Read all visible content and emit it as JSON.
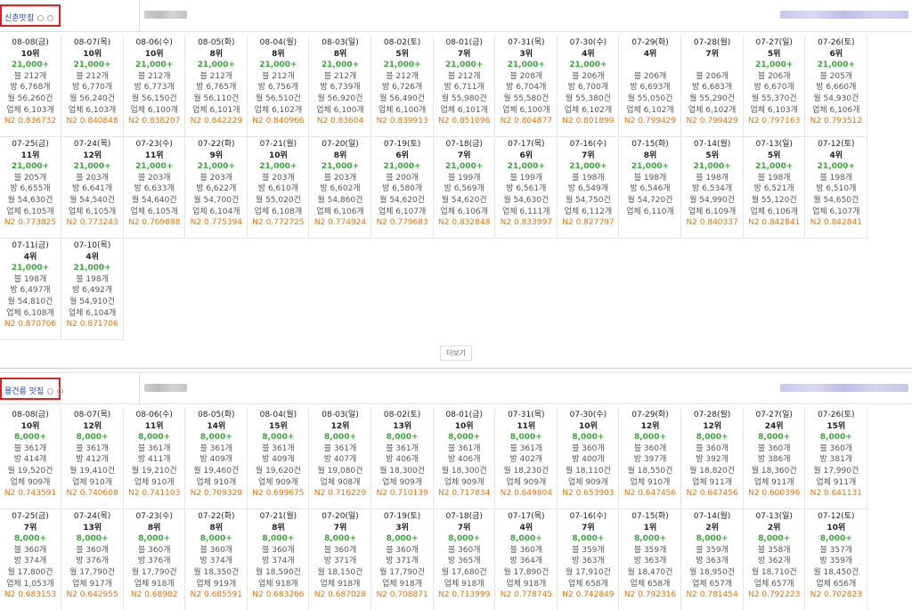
{
  "sections": [
    {
      "keyword": "신촌맛집",
      "more_label": "더보기",
      "rows": [
        [
          {
            "date": "08-08(금)",
            "rank": "10위",
            "amount": "21,000+",
            "blog": "블 212개",
            "cafe": "방 6,768개",
            "month": "월 56,260건",
            "biz": "업체 6,103개",
            "n2": "N2 0.836732"
          },
          {
            "date": "08-07(목)",
            "rank": "10위",
            "amount": "21,000+",
            "blog": "블 212개",
            "cafe": "방 6,770개",
            "month": "월 56,240건",
            "biz": "업체 6,103개",
            "n2": "N2 0.840848"
          },
          {
            "date": "08-06(수)",
            "rank": "10위",
            "amount": "21,000+",
            "blog": "블 212개",
            "cafe": "방 6,773개",
            "month": "월 56,150건",
            "biz": "업체 6,100개",
            "n2": "N2 0.838207"
          },
          {
            "date": "08-05(화)",
            "rank": "8위",
            "amount": "21,000+",
            "blog": "블 212개",
            "cafe": "방 6,765개",
            "month": "월 56,110건",
            "biz": "업체 6,101개",
            "n2": "N2 0.842229"
          },
          {
            "date": "08-04(월)",
            "rank": "8위",
            "amount": "21,000+",
            "blog": "블 212개",
            "cafe": "방 6,756개",
            "month": "월 56,510건",
            "biz": "업체 6,102개",
            "n2": "N2 0.840966"
          },
          {
            "date": "08-03(일)",
            "rank": "8위",
            "amount": "21,000+",
            "blog": "블 212개",
            "cafe": "방 6,739개",
            "month": "월 56,920건",
            "biz": "업체 6,100개",
            "n2": "N2 0.83604"
          },
          {
            "date": "08-02(토)",
            "rank": "5위",
            "amount": "21,000+",
            "blog": "블 212개",
            "cafe": "방 6,726개",
            "month": "월 56,490건",
            "biz": "업체 6,100개",
            "n2": "N2 0.839913"
          },
          {
            "date": "08-01(금)",
            "rank": "7위",
            "amount": "21,000+",
            "blog": "블 212개",
            "cafe": "방 6,711개",
            "month": "월 55,980건",
            "biz": "업체 6,101개",
            "n2": "N2 0.851096"
          },
          {
            "date": "07-31(목)",
            "rank": "3위",
            "amount": "21,000+",
            "blog": "블 208개",
            "cafe": "방 6,704개",
            "month": "월 55,580건",
            "biz": "업체 6,100개",
            "n2": "N2 0.804877"
          },
          {
            "date": "07-30(수)",
            "rank": "4위",
            "amount": "21,000+",
            "blog": "블 206개",
            "cafe": "방 6,700개",
            "month": "월 55,380건",
            "biz": "업체 6,102개",
            "n2": "N2 0.801899"
          },
          {
            "date": "07-29(화)",
            "rank": "4위",
            "amount": "",
            "blog": "블 206개",
            "cafe": "방 6,693개",
            "month": "월 55,050건",
            "biz": "업체 6,102개",
            "n2": "N2 0.799429"
          },
          {
            "date": "07-28(월)",
            "rank": "7위",
            "amount": "",
            "blog": "블 206개",
            "cafe": "방 6,683개",
            "month": "월 55,290건",
            "biz": "업체 6,102개",
            "n2": "N2 0.799429"
          },
          {
            "date": "07-27(일)",
            "rank": "5위",
            "amount": "21,000+",
            "blog": "블 206개",
            "cafe": "방 6,670개",
            "month": "월 55,370건",
            "biz": "업체 6,103개",
            "n2": "N2 0.797163"
          },
          {
            "date": "07-26(토)",
            "rank": "6위",
            "amount": "21,000+",
            "blog": "블 205개",
            "cafe": "방 6,660개",
            "month": "월 54,930건",
            "biz": "업체 6,106개",
            "n2": "N2 0.793512"
          }
        ],
        [
          {
            "date": "07-25(금)",
            "rank": "11위",
            "amount": "21,000+",
            "blog": "블 205개",
            "cafe": "방 6,655개",
            "month": "월 54,630건",
            "biz": "업체 6,105개",
            "n2": "N2 0.773825"
          },
          {
            "date": "07-24(목)",
            "rank": "12위",
            "amount": "21,000+",
            "blog": "블 203개",
            "cafe": "방 6,641개",
            "month": "월 54,540건",
            "biz": "업체 6,105개",
            "n2": "N2 0.773243"
          },
          {
            "date": "07-23(수)",
            "rank": "11위",
            "amount": "21,000+",
            "blog": "블 203개",
            "cafe": "방 6,633개",
            "month": "월 54,640건",
            "biz": "업체 6,105개",
            "n2": "N2 0.769888"
          },
          {
            "date": "07-22(화)",
            "rank": "9위",
            "amount": "21,000+",
            "blog": "블 203개",
            "cafe": "방 6,622개",
            "month": "월 54,700건",
            "biz": "업체 6,104개",
            "n2": "N2 0.775394"
          },
          {
            "date": "07-21(월)",
            "rank": "10위",
            "amount": "21,000+",
            "blog": "블 203개",
            "cafe": "방 6,610개",
            "month": "월 55,020건",
            "biz": "업체 6,108개",
            "n2": "N2 0.772725"
          },
          {
            "date": "07-20(일)",
            "rank": "8위",
            "amount": "21,000+",
            "blog": "블 203개",
            "cafe": "방 6,602개",
            "month": "월 54,860건",
            "biz": "업체 6,106개",
            "n2": "N2 0.774924"
          },
          {
            "date": "07-19(토)",
            "rank": "6위",
            "amount": "21,000+",
            "blog": "블 200개",
            "cafe": "방 6,580개",
            "month": "월 54,620건",
            "biz": "업체 6,107개",
            "n2": "N2 0.779683"
          },
          {
            "date": "07-18(금)",
            "rank": "7위",
            "amount": "21,000+",
            "blog": "블 199개",
            "cafe": "방 6,569개",
            "month": "월 54,620건",
            "biz": "업체 6,106개",
            "n2": "N2 0.832848"
          },
          {
            "date": "07-17(목)",
            "rank": "6위",
            "amount": "21,000+",
            "blog": "블 199개",
            "cafe": "방 6,561개",
            "month": "월 54,630건",
            "biz": "업체 6,111개",
            "n2": "N2 0.833997"
          },
          {
            "date": "07-16(수)",
            "rank": "7위",
            "amount": "21,000+",
            "blog": "블 198개",
            "cafe": "방 6,549개",
            "month": "월 54,750건",
            "biz": "업체 6,112개",
            "n2": "N2 0.827797"
          },
          {
            "date": "07-15(화)",
            "rank": "8위",
            "amount": "21,000+",
            "blog": "블 198개",
            "cafe": "방 6,546개",
            "month": "월 54,720건",
            "biz": "업체 6,110개",
            "n2": ""
          },
          {
            "date": "07-14(월)",
            "rank": "5위",
            "amount": "21,000+",
            "blog": "블 198개",
            "cafe": "방 6,534개",
            "month": "월 54,990건",
            "biz": "업체 6,109개",
            "n2": "N2 0.840337"
          },
          {
            "date": "07-13(일)",
            "rank": "5위",
            "amount": "21,000+",
            "blog": "블 198개",
            "cafe": "방 6,521개",
            "month": "월 55,120건",
            "biz": "업체 6,106개",
            "n2": "N2 0.842841"
          },
          {
            "date": "07-12(토)",
            "rank": "4위",
            "amount": "21,000+",
            "blog": "블 198개",
            "cafe": "방 6,510개",
            "month": "월 54,650건",
            "biz": "업체 6,107개",
            "n2": "N2 0.842841"
          }
        ],
        [
          {
            "date": "07-11(금)",
            "rank": "4위",
            "amount": "21,000+",
            "blog": "블 198개",
            "cafe": "방 6,497개",
            "month": "월 54,810건",
            "biz": "업체 6,108개",
            "n2": "N2 0.870706"
          },
          {
            "date": "07-10(목)",
            "rank": "4위",
            "amount": "21,000+",
            "blog": "블 198개",
            "cafe": "방 6,492개",
            "month": "월 54,910건",
            "biz": "업체 6,104개",
            "n2": "N2 0.871706"
          }
        ]
      ]
    },
    {
      "keyword": "용건릉 맛집",
      "rows": [
        [
          {
            "date": "08-08(금)",
            "rank": "10위",
            "amount": "8,000+",
            "blog": "블 361개",
            "cafe": "방 414개",
            "month": "월 19,520건",
            "biz": "업체 909개",
            "n2": "N2 0.743591"
          },
          {
            "date": "08-07(목)",
            "rank": "12위",
            "amount": "8,000+",
            "blog": "블 361개",
            "cafe": "방 412개",
            "month": "월 19,410건",
            "biz": "업체 910개",
            "n2": "N2 0.740608"
          },
          {
            "date": "08-06(수)",
            "rank": "11위",
            "amount": "8,000+",
            "blog": "블 361개",
            "cafe": "방 411개",
            "month": "월 19,210건",
            "biz": "업체 910개",
            "n2": "N2 0.741103"
          },
          {
            "date": "08-05(화)",
            "rank": "14위",
            "amount": "8,000+",
            "blog": "블 361개",
            "cafe": "방 409개",
            "month": "월 19,460건",
            "biz": "업체 910개",
            "n2": "N2 0.709329"
          },
          {
            "date": "08-04(월)",
            "rank": "15위",
            "amount": "8,000+",
            "blog": "블 361개",
            "cafe": "방 409개",
            "month": "월 19,620건",
            "biz": "업체 909개",
            "n2": "N2 0.699675"
          },
          {
            "date": "08-03(일)",
            "rank": "12위",
            "amount": "8,000+",
            "blog": "블 361개",
            "cafe": "방 407개",
            "month": "월 19,080건",
            "biz": "업체 908개",
            "n2": "N2 0.716229"
          },
          {
            "date": "08-02(토)",
            "rank": "13위",
            "amount": "8,000+",
            "blog": "블 361개",
            "cafe": "방 406개",
            "month": "월 18,300건",
            "biz": "업체 909개",
            "n2": "N2 0.710139"
          },
          {
            "date": "08-01(금)",
            "rank": "10위",
            "amount": "8,000+",
            "blog": "블 361개",
            "cafe": "방 406개",
            "month": "월 18,300건",
            "biz": "업체 909개",
            "n2": "N2 0.717834"
          },
          {
            "date": "07-31(목)",
            "rank": "11위",
            "amount": "8,000+",
            "blog": "블 361개",
            "cafe": "방 402개",
            "month": "월 18,230건",
            "biz": "업체 909개",
            "n2": "N2 0.649804"
          },
          {
            "date": "07-30(수)",
            "rank": "10위",
            "amount": "8,000+",
            "blog": "블 360개",
            "cafe": "방 400개",
            "month": "월 18,110건",
            "biz": "업체 909개",
            "n2": "N2 0.653903"
          },
          {
            "date": "07-29(화)",
            "rank": "12위",
            "amount": "8,000+",
            "blog": "블 360개",
            "cafe": "방 397개",
            "month": "월 18,550건",
            "biz": "업체 910개",
            "n2": "N2 0.647456"
          },
          {
            "date": "07-28(월)",
            "rank": "12위",
            "amount": "8,000+",
            "blog": "블 360개",
            "cafe": "방 392개",
            "month": "월 18,820건",
            "biz": "업체 911개",
            "n2": "N2 0.647456"
          },
          {
            "date": "07-27(일)",
            "rank": "24위",
            "amount": "8,000+",
            "blog": "블 360개",
            "cafe": "방 386개",
            "month": "월 18,360건",
            "biz": "업체 911개",
            "n2": "N2 0.600396"
          },
          {
            "date": "07-26(토)",
            "rank": "15위",
            "amount": "8,000+",
            "blog": "블 360개",
            "cafe": "방 381개",
            "month": "월 17,990건",
            "biz": "업체 911개",
            "n2": "N2 0.641131"
          }
        ],
        [
          {
            "date": "07-25(금)",
            "rank": "7위",
            "amount": "8,000+",
            "blog": "블 360개",
            "cafe": "방 374개",
            "month": "월 17,800건",
            "biz": "업체 1,053개",
            "n2": "N2 0.683153"
          },
          {
            "date": "07-24(목)",
            "rank": "13위",
            "amount": "8,000+",
            "blog": "블 360개",
            "cafe": "방 376개",
            "month": "월 17,790건",
            "biz": "업체 917개",
            "n2": "N2 0.642955"
          },
          {
            "date": "07-23(수)",
            "rank": "8위",
            "amount": "8,000+",
            "blog": "블 360개",
            "cafe": "방 376개",
            "month": "월 17,790건",
            "biz": "업체 918개",
            "n2": "N2 0.68982"
          },
          {
            "date": "07-22(화)",
            "rank": "8위",
            "amount": "8,000+",
            "blog": "블 360개",
            "cafe": "방 374개",
            "month": "월 18,350건",
            "biz": "업체 919개",
            "n2": "N2 0.685591"
          },
          {
            "date": "07-21(월)",
            "rank": "8위",
            "amount": "8,000+",
            "blog": "블 360개",
            "cafe": "방 374개",
            "month": "월 18,590건",
            "biz": "업체 918개",
            "n2": "N2 0.683266"
          },
          {
            "date": "07-20(일)",
            "rank": "7위",
            "amount": "8,000+",
            "blog": "블 360개",
            "cafe": "방 371개",
            "month": "월 18,150건",
            "biz": "업체 918개",
            "n2": "N2 0.687028"
          },
          {
            "date": "07-19(토)",
            "rank": "3위",
            "amount": "8,000+",
            "blog": "블 360개",
            "cafe": "방 371개",
            "month": "월 17,790건",
            "biz": "업체 918개",
            "n2": "N2 0.708871"
          },
          {
            "date": "07-18(금)",
            "rank": "7위",
            "amount": "8,000+",
            "blog": "블 360개",
            "cafe": "방 365개",
            "month": "월 17,680건",
            "biz": "업체 918개",
            "n2": "N2 0.713999"
          },
          {
            "date": "07-17(목)",
            "rank": "4위",
            "amount": "8,000+",
            "blog": "블 360개",
            "cafe": "방 364개",
            "month": "월 17,890건",
            "biz": "업체 918개",
            "n2": "N2 0.778745"
          },
          {
            "date": "07-16(수)",
            "rank": "7위",
            "amount": "8,000+",
            "blog": "블 359개",
            "cafe": "방 363개",
            "month": "월 17,910건",
            "biz": "업체 658개",
            "n2": "N2 0.742849"
          },
          {
            "date": "07-15(화)",
            "rank": "1위",
            "amount": "8,000+",
            "blog": "블 359개",
            "cafe": "방 363개",
            "month": "월 18,470건",
            "biz": "업체 658개",
            "n2": "N2 0.792316"
          },
          {
            "date": "07-14(월)",
            "rank": "2위",
            "amount": "8,000+",
            "blog": "블 359개",
            "cafe": "방 363개",
            "month": "월 18,950건",
            "biz": "업체 657개",
            "n2": "N2 0.781454"
          },
          {
            "date": "07-13(일)",
            "rank": "2위",
            "amount": "8,000+",
            "blog": "블 358개",
            "cafe": "방 362개",
            "month": "월 18,710건",
            "biz": "업체 657개",
            "n2": "N2 0.792223"
          },
          {
            "date": "07-12(토)",
            "rank": "10위",
            "amount": "8,000+",
            "blog": "블 357개",
            "cafe": "방 359개",
            "month": "월 18,450건",
            "biz": "업체 656개",
            "n2": "N2 0.702823"
          }
        ]
      ]
    }
  ],
  "colors": {
    "keyword_border": "#e02020",
    "keyword_text": "#1a3fbf",
    "amount": "#38a838",
    "n2": "#e8750a"
  }
}
